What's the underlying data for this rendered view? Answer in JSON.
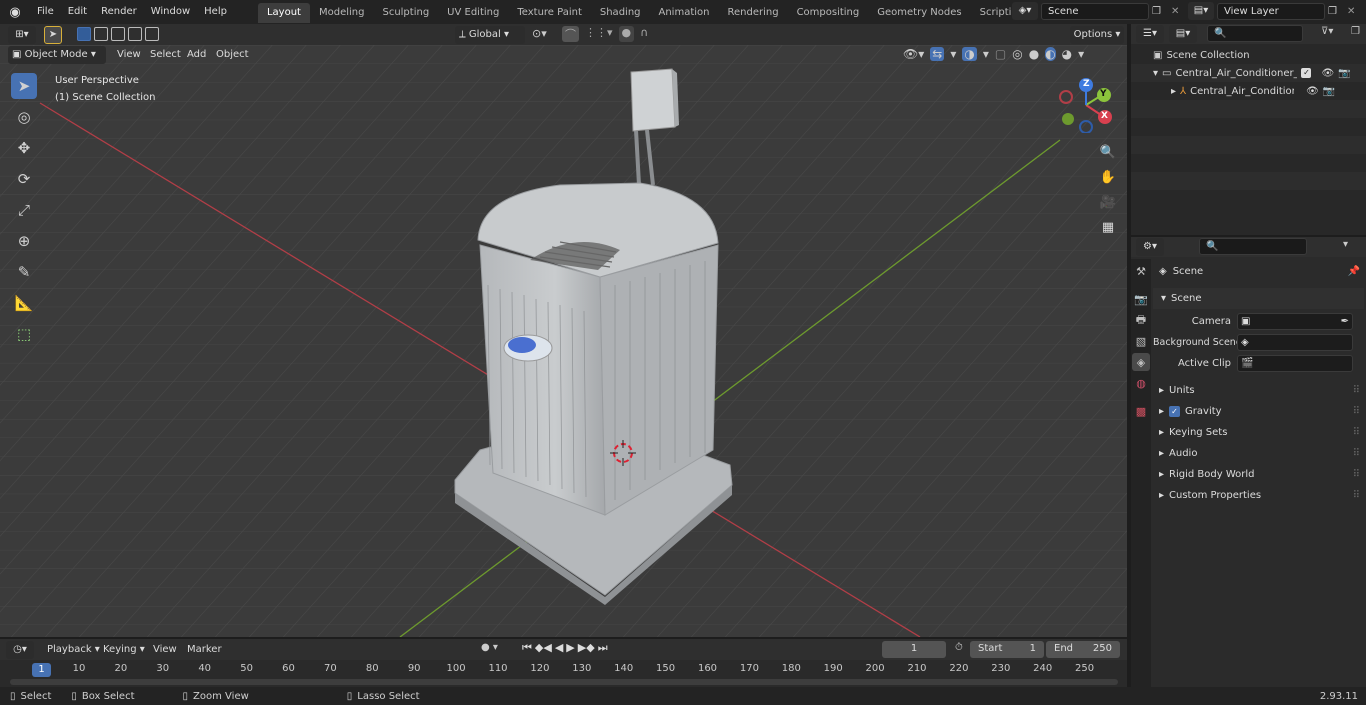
{
  "menus": [
    "File",
    "Edit",
    "Render",
    "Window",
    "Help"
  ],
  "workspaces": [
    {
      "label": "Layout",
      "active": true
    },
    {
      "label": "Modeling"
    },
    {
      "label": "Sculpting"
    },
    {
      "label": "UV Editing"
    },
    {
      "label": "Texture Paint"
    },
    {
      "label": "Shading"
    },
    {
      "label": "Animation"
    },
    {
      "label": "Rendering"
    },
    {
      "label": "Compositing"
    },
    {
      "label": "Geometry Nodes"
    },
    {
      "label": "Scripting"
    }
  ],
  "add_workspace": "+",
  "scene_name": "Scene",
  "view_layer": "View Layer",
  "header": {
    "transform_orientation": "Global",
    "options": "Options",
    "mode": "Object Mode",
    "view": "View",
    "select": "Select",
    "add": "Add",
    "object": "Object"
  },
  "viewport": {
    "perspective": "User Perspective",
    "collection": "(1) Scene Collection",
    "gizmo": {
      "x": "X",
      "y": "Y",
      "z": "Z"
    }
  },
  "outliner": {
    "root": "Scene Collection",
    "collection": "Central_Air_Conditioner_Cam",
    "object": "Central_Air_Conditioner_"
  },
  "properties": {
    "context": "Scene",
    "section": "Scene",
    "camera_label": "Camera",
    "background_label": "Background Scene",
    "clip_label": "Active Clip",
    "panels": [
      "Units",
      "Gravity",
      "Keying Sets",
      "Audio",
      "Rigid Body World",
      "Custom Properties"
    ]
  },
  "timeline": {
    "playback": "Playback",
    "keying": "Keying",
    "view": "View",
    "marker": "Marker",
    "current_frame": "1",
    "start_label": "Start",
    "start": "1",
    "end_label": "End",
    "end": "250",
    "playhead": "1",
    "ticks": [
      "10",
      "20",
      "30",
      "40",
      "50",
      "60",
      "70",
      "80",
      "90",
      "100",
      "110",
      "120",
      "130",
      "140",
      "150",
      "160",
      "170",
      "180",
      "190",
      "200",
      "210",
      "220",
      "230",
      "240",
      "250"
    ]
  },
  "status": {
    "select": "Select",
    "box_select": "Box Select",
    "zoom_view": "Zoom View",
    "lasso_select": "Lasso Select",
    "version": "2.93.11"
  },
  "colors": {
    "accent": "#4772b3",
    "x_axis": "#d8404f",
    "y_axis": "#8cc43c",
    "z_axis": "#3e7be0"
  }
}
